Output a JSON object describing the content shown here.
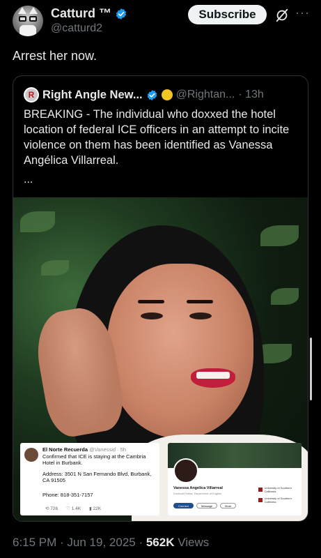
{
  "author": {
    "name": "Catturd ™",
    "handle": "@catturd2",
    "verified_color": "#1d9bf0"
  },
  "actions": {
    "subscribe_label": "Subscribe",
    "grok_icon": "grok-icon",
    "more_icon": "more-icon"
  },
  "tweet": {
    "text": "Arrest her now."
  },
  "quote": {
    "name": "Right Angle New...",
    "handle": "@Rightan...",
    "time": "· 13h",
    "logo_letter": "R",
    "text": "BREAKING - The individual who doxxed the hotel location of federal ICE officers in an attempt to incite violence on them has been identified as Vanessa Angélica Villarreal.",
    "ellipsis": "..."
  },
  "embedded_screenshot_1": {
    "name": "El Norte Recuerda",
    "handle": "@Vanessid · 5h",
    "line1": "Confirmed that ICE is staying at the Cambria Hotel in Burbank.",
    "address": "Address: 3501 N San Fernando Blvd, Burbank, CA 91505",
    "phone": "Phone: 818-351-7157",
    "stats": [
      "726",
      "1.4K",
      "22K"
    ]
  },
  "embedded_screenshot_2": {
    "name": "Vanessa Angelica Villarreal",
    "subtitle": "Doctoral Fellow, Department of English",
    "buttons": [
      "Connect",
      "Message",
      "More"
    ],
    "edu": [
      "University of Southern California",
      "University of Southern California"
    ]
  },
  "footer": {
    "time": "6:15 PM · Jun 19, 2025 · ",
    "views_count": "562K",
    "views_label": " Views"
  }
}
